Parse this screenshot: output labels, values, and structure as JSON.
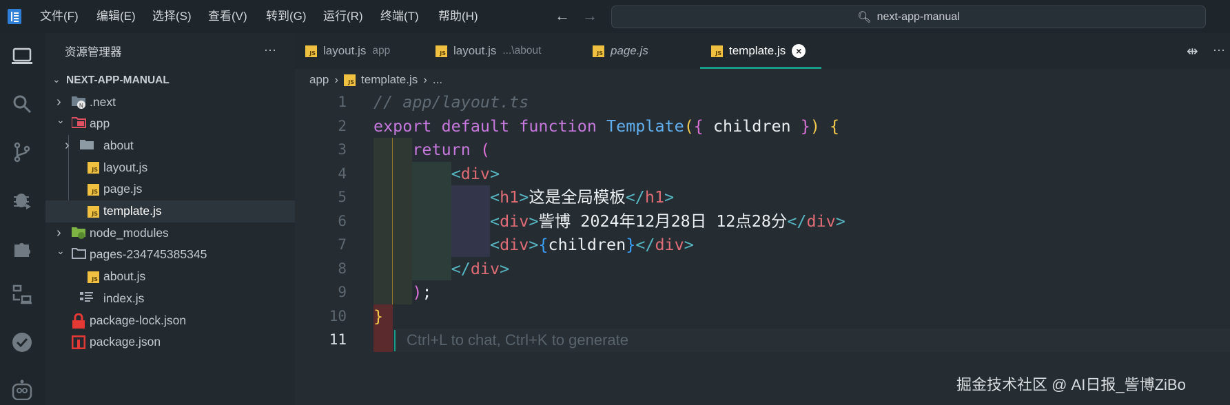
{
  "menu": [
    "文件(F)",
    "编辑(E)",
    "选择(S)",
    "查看(V)",
    "转到(G)",
    "运行(R)",
    "终端(T)",
    "帮助(H)"
  ],
  "search": {
    "text": "next-app-manual"
  },
  "sidebar": {
    "title": "资源管理器",
    "more": "···",
    "root": "NEXT-APP-MANUAL",
    "items": [
      {
        "label": ".next",
        "level": 0,
        "type": "folder-next",
        "expanded": false
      },
      {
        "label": "app",
        "level": 0,
        "type": "folder-app",
        "expanded": true
      },
      {
        "label": "about",
        "level": 1,
        "type": "folder",
        "expanded": false
      },
      {
        "label": "layout.js",
        "level": 1,
        "type": "js"
      },
      {
        "label": "page.js",
        "level": 1,
        "type": "js"
      },
      {
        "label": "template.js",
        "level": 1,
        "type": "js",
        "selected": true
      },
      {
        "label": "node_modules",
        "level": 0,
        "type": "folder-node",
        "expanded": false
      },
      {
        "label": "pages-234745385345",
        "level": 0,
        "type": "folder-open",
        "expanded": true
      },
      {
        "label": "about.js",
        "level": 1,
        "type": "js"
      },
      {
        "label": "index.js",
        "level": 1,
        "type": "list"
      },
      {
        "label": "package-lock.json",
        "level": 0,
        "type": "lock"
      },
      {
        "label": "package.json",
        "level": 0,
        "type": "npm"
      }
    ]
  },
  "tabs": [
    {
      "label": "layout.js",
      "hint": "app"
    },
    {
      "label": "layout.js",
      "hint": "...\\about"
    },
    {
      "label": "page.js",
      "hint": "",
      "italic": true
    },
    {
      "label": "template.js",
      "hint": "",
      "active": true
    }
  ],
  "tab_actions": {
    "more": "···"
  },
  "breadcrumb": {
    "folder": "app",
    "file": "template.js",
    "rest": "..."
  },
  "code": {
    "line_numbers": [
      "1",
      "2",
      "3",
      "4",
      "5",
      "6",
      "7",
      "8",
      "9",
      "10",
      "11"
    ],
    "lines": [
      [
        [
          "// app/layout.ts",
          "cm"
        ]
      ],
      [
        [
          "export",
          "kw"
        ],
        [
          " ",
          "tx"
        ],
        [
          "default",
          "kw"
        ],
        [
          " ",
          "tx"
        ],
        [
          "function",
          "kw"
        ],
        [
          " ",
          "tx"
        ],
        [
          "Template",
          "fn"
        ],
        [
          "(",
          "y"
        ],
        [
          "{",
          "p"
        ],
        [
          " children ",
          "tx"
        ],
        [
          "}",
          "p"
        ],
        [
          ")",
          "y"
        ],
        [
          " ",
          "tx"
        ],
        [
          "{",
          "y"
        ]
      ],
      [
        [
          "    ",
          "tx"
        ],
        [
          "return",
          "kw"
        ],
        [
          " ",
          "tx"
        ],
        [
          "(",
          "p"
        ]
      ],
      [
        [
          "        ",
          "tx"
        ],
        [
          "<",
          "ab"
        ],
        [
          "div",
          "tg"
        ],
        [
          ">",
          "ab"
        ]
      ],
      [
        [
          "            ",
          "tx"
        ],
        [
          "<",
          "ab"
        ],
        [
          "h1",
          "tg"
        ],
        [
          ">",
          "ab"
        ],
        [
          "这是全局模板",
          "tx"
        ],
        [
          "</",
          "ab"
        ],
        [
          "h1",
          "tg"
        ],
        [
          ">",
          "ab"
        ]
      ],
      [
        [
          "            ",
          "tx"
        ],
        [
          "<",
          "ab"
        ],
        [
          "div",
          "tg"
        ],
        [
          ">",
          "ab"
        ],
        [
          "訾博 2024年12月28日 12点28分",
          "tx"
        ],
        [
          "</",
          "ab"
        ],
        [
          "div",
          "tg"
        ],
        [
          ">",
          "ab"
        ]
      ],
      [
        [
          "            ",
          "tx"
        ],
        [
          "<",
          "ab"
        ],
        [
          "div",
          "tg"
        ],
        [
          ">",
          "ab"
        ],
        [
          "{",
          "b"
        ],
        [
          "children",
          "tx"
        ],
        [
          "}",
          "b"
        ],
        [
          "</",
          "ab"
        ],
        [
          "div",
          "tg"
        ],
        [
          ">",
          "ab"
        ]
      ],
      [
        [
          "        ",
          "tx"
        ],
        [
          "</",
          "ab"
        ],
        [
          "div",
          "tg"
        ],
        [
          ">",
          "ab"
        ]
      ],
      [
        [
          "    ",
          "tx"
        ],
        [
          ")",
          "p"
        ],
        [
          ";",
          "tx"
        ]
      ],
      [
        [
          "}",
          "y"
        ]
      ],
      []
    ],
    "hint": "Ctrl+L to chat, Ctrl+K to generate",
    "active_line": "11"
  },
  "watermark": "掘金技术社区 @ AI日报_訾博ZiBo",
  "colors": {
    "accent": "#1a9b8a",
    "background": "#242c32"
  }
}
